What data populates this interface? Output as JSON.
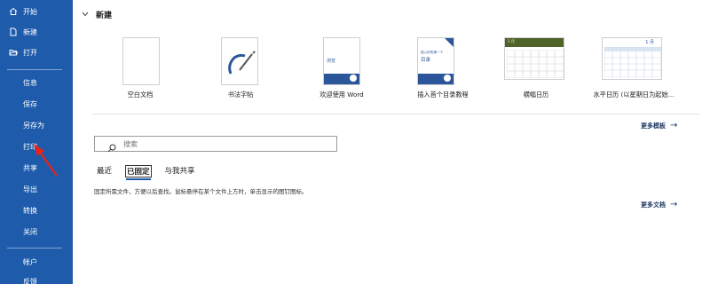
{
  "sidebar": {
    "items": [
      {
        "label": "开始",
        "icon": "home-icon"
      },
      {
        "label": "新建",
        "icon": "new-file-icon"
      },
      {
        "label": "打开",
        "icon": "folder-open-icon"
      },
      {
        "label": "信息"
      },
      {
        "label": "保存"
      },
      {
        "label": "另存为"
      },
      {
        "label": "打印"
      },
      {
        "label": "共享"
      },
      {
        "label": "导出"
      },
      {
        "label": "转换"
      },
      {
        "label": "关闭"
      },
      {
        "label": "帐户"
      },
      {
        "label": "反馈"
      }
    ]
  },
  "new_section": {
    "title": "新建",
    "templates": [
      {
        "label": "空白文档"
      },
      {
        "label": "书法字帖"
      },
      {
        "label": "欢迎使用 Word",
        "thumb_text": "浏览"
      },
      {
        "label": "插入首个目录教程",
        "thumb_text_1": "插入你的第一个",
        "thumb_text_2": "目录"
      },
      {
        "label": "横幅日历",
        "thumb_month": "1 月"
      },
      {
        "label": "水平日历 (以星期日为起始...",
        "thumb_month": "1 月"
      }
    ],
    "more_templates": "更多模板"
  },
  "search": {
    "placeholder": "搜索"
  },
  "tabs": [
    {
      "label": "最近"
    },
    {
      "label": "已固定"
    },
    {
      "label": "与我共享"
    }
  ],
  "pinned_hint": "固定所需文件，方便以后查找。鼠标悬停在某个文件上方时，单击显示的图钉图标。",
  "more_documents": "更多文档",
  "colors": {
    "sidebar": "#1e5bab",
    "accent": "#2b579a",
    "calendar_header": "#4f6228",
    "annotation_arrow": "#e8231a"
  }
}
